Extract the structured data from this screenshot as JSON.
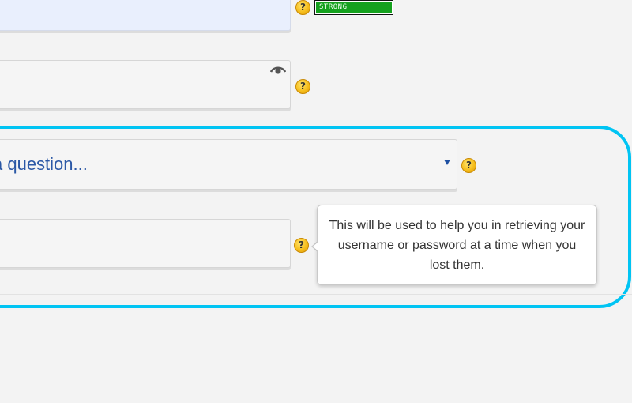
{
  "password_field": {
    "help_icon": "?",
    "strength_label": "STRONG",
    "strength_color": "#15a11e"
  },
  "confirm_field": {
    "help_icon": "?",
    "visibility_icon": "eye-icon"
  },
  "security_question": {
    "selected_value": "a question...",
    "help_icon": "?"
  },
  "security_answer": {
    "help_icon": "?",
    "tooltip_text": "This will be used to help you in retrieving your username or password at a time when you lost them."
  },
  "colors": {
    "highlight_border": "#00c4f3",
    "select_text": "#2b58a6",
    "help_icon": "#f6be1c"
  }
}
